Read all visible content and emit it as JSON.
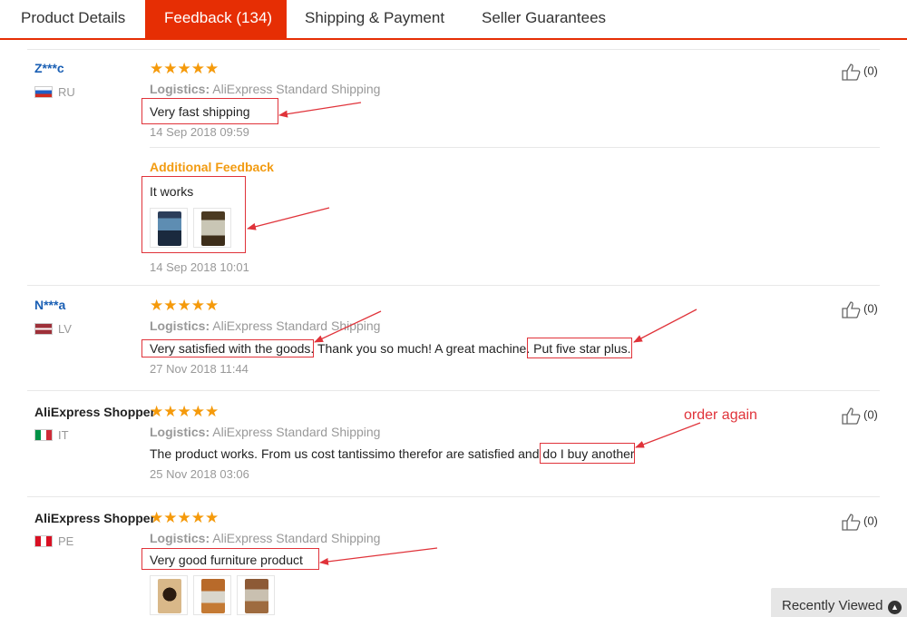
{
  "tabs": [
    {
      "label": "Product Details"
    },
    {
      "label": "Feedback (134)"
    },
    {
      "label": "Shipping & Payment"
    },
    {
      "label": "Seller Guarantees"
    }
  ],
  "reviews": [
    {
      "user": "Z***c",
      "country": "RU",
      "stars": "★★★★★",
      "rating": 5,
      "logistics_label": "Logistics:",
      "logistics_value": "AliExpress Standard Shipping",
      "text": "Very fast shipping",
      "date": "14 Sep 2018 09:59",
      "helpful": "(0)",
      "additional": {
        "label": "Additional Feedback",
        "text": "It works",
        "date": "14 Sep 2018 10:01"
      }
    },
    {
      "user": "N***a",
      "country": "LV",
      "stars": "★★★★★",
      "rating": 5,
      "logistics_label": "Logistics:",
      "logistics_value": "AliExpress Standard Shipping",
      "text_parts": [
        "Very satisfied with the goods.",
        " Thank you so much! A great machine. ",
        "Put five star plus."
      ],
      "date": "27 Nov 2018 11:44",
      "helpful": "(0)"
    },
    {
      "user": "AliExpress Shopper",
      "country": "IT",
      "stars": "★★★★★",
      "rating": 5,
      "logistics_label": "Logistics:",
      "logistics_value": "AliExpress Standard Shipping",
      "text_parts": [
        "The product works. From us cost tantissimo therefor are satisfied and ",
        "do I buy another"
      ],
      "date": "25 Nov 2018 03:06",
      "helpful": "(0)"
    },
    {
      "user": "AliExpress Shopper",
      "country": "PE",
      "stars": "★★★★★",
      "rating": 5,
      "logistics_label": "Logistics:",
      "logistics_value": "AliExpress Standard Shipping",
      "text": "Very good furniture product",
      "helpful": "(0)"
    }
  ],
  "annotation": "order again",
  "recently_viewed": "Recently Viewed",
  "icons": {
    "helpful": "thumbs-up-icon",
    "scroll_top": "chevron-up-icon"
  },
  "colors": {
    "accent": "#e62e04",
    "star": "#f59a0b",
    "annotation": "#e0333a",
    "additional": "#f29b11",
    "user_link": "#1a5fb4"
  }
}
